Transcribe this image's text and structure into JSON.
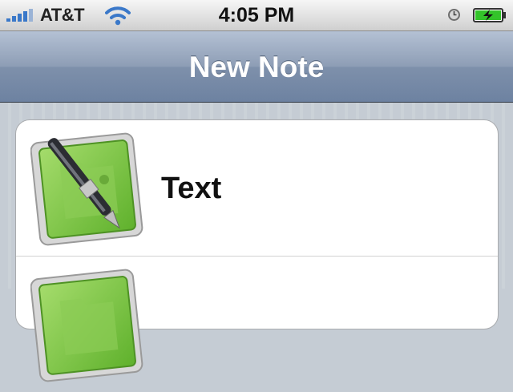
{
  "status_bar": {
    "carrier": "AT&T",
    "time": "4:05 PM",
    "icons": [
      "signal-bars-icon",
      "wifi-icon",
      "clock-icon",
      "battery-charging-icon"
    ]
  },
  "nav": {
    "title": "New Note"
  },
  "menu": {
    "items": [
      {
        "label": "Text",
        "icon": "text-note-icon"
      },
      {
        "label": "",
        "icon": "note-icon"
      }
    ]
  },
  "colors": {
    "nav_bar": "#7e90ab",
    "signal_blue": "#3a78c9",
    "icon_green": "#7dc544",
    "battery_green": "#33c42a"
  }
}
